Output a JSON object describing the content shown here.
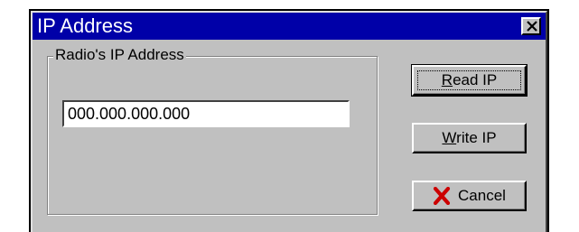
{
  "dialog": {
    "title": "IP Address",
    "close_glyph": "✕",
    "group_label": "Radio's IP Address",
    "ip_value": "000.000.000.000"
  },
  "buttons": {
    "read_ip": {
      "accel": "R",
      "rest": "ead IP"
    },
    "write_ip": {
      "accel": "W",
      "rest": "rite IP"
    },
    "cancel": {
      "label": "Cancel",
      "icon": "red-x-icon"
    }
  },
  "colors": {
    "titlebar": "#0000a8",
    "face": "#c0c0c0",
    "cancel_icon": "#cc0000"
  }
}
